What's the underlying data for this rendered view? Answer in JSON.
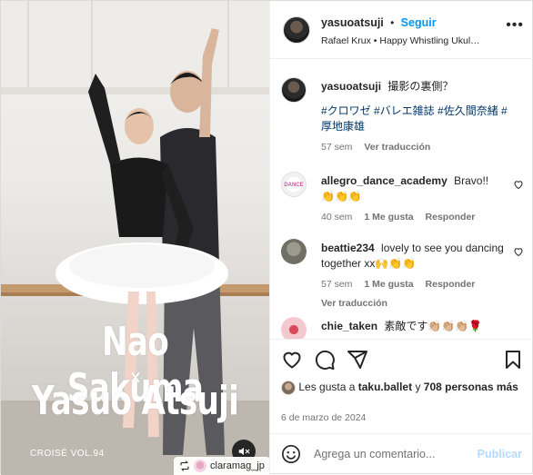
{
  "media": {
    "overlay_line1": "Nao Sakuma",
    "overlay_x": "×",
    "overlay_line2": "Yasuo Atsuji",
    "magazine_tag": "CROISÉ VOL.94",
    "repost_user": "claramag_jp",
    "mute_icon": "speaker-muted-icon"
  },
  "header": {
    "username": "yasuoatsuji",
    "separator": "•",
    "follow_label": "Seguir",
    "audio_line": "Rafael Krux • Happy Whistling Ukul…",
    "more_label": "•••"
  },
  "caption": {
    "username": "yasuoatsuji",
    "text": "撮影の裏側？",
    "hashtags": "#クロワゼ #バレエ雑誌 #佐久間奈緒 #厚地康雄",
    "time": "57 sem",
    "translate": "Ver traducción"
  },
  "comments": [
    {
      "username": "allegro_dance_academy",
      "text": "Bravo!!",
      "emoji": "👏👏👏",
      "time": "40 sem",
      "likes": "1 Me gusta",
      "reply": "Responder",
      "translate": ""
    },
    {
      "username": "beattie234",
      "text": "lovely to see you dancing together xx🙌👏👏",
      "emoji": "",
      "time": "57 sem",
      "likes": "1 Me gusta",
      "reply": "Responder",
      "translate": "Ver traducción"
    },
    {
      "username": "chie_taken",
      "text": "素敵です👏🏼👏🏼👏🏼🌹",
      "emoji": "",
      "time": "",
      "likes": "",
      "reply": "",
      "translate": ""
    }
  ],
  "actions": {
    "icons": [
      "heart-icon",
      "comment-icon",
      "share-icon",
      "bookmark-icon"
    ],
    "likes_prefix": "Les gusta a",
    "likes_user": "taku.ballet",
    "likes_conj": "y",
    "likes_count": "708 personas más",
    "date": "6 de marzo de 2024"
  },
  "composer": {
    "placeholder": "Agrega un comentario...",
    "publish_label": "Publicar"
  },
  "colors": {
    "accent": "#0095f6",
    "hashtag": "#00376b",
    "muted": "#737373",
    "publish_disabled": "#b3dbff"
  }
}
